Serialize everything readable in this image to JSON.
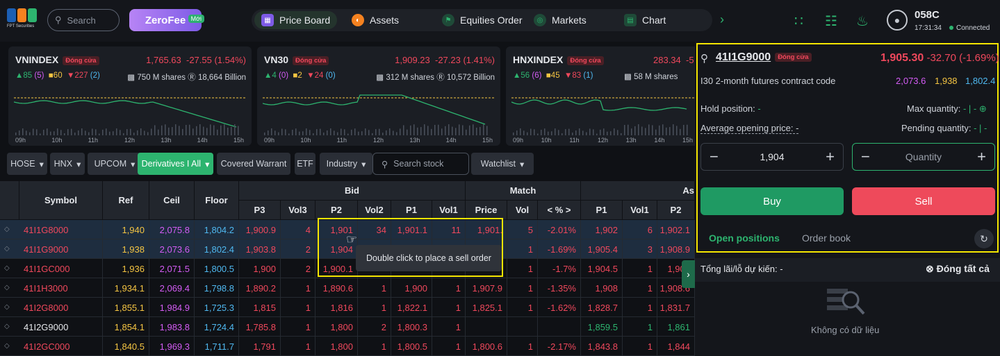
{
  "brand": {
    "logo_text": "FPT Securities",
    "logo_colors": [
      "#1c5fb4",
      "#f58220",
      "#2db46f"
    ]
  },
  "header": {
    "search_placeholder": "Search",
    "zerofee_label": "ZeroFee",
    "zerofee_badge": "Mới",
    "nav": [
      {
        "label": "Price Board",
        "icon": "price-board-icon",
        "active": true
      },
      {
        "label": "Assets",
        "icon": "assets-icon"
      },
      {
        "label": "Equities Order",
        "icon": "equities-order-icon"
      },
      {
        "label": "Markets",
        "icon": "markets-icon"
      },
      {
        "label": "Chart",
        "icon": "chart-icon"
      }
    ],
    "account_id": "058C",
    "time": "17:31:34",
    "connection": "Connected"
  },
  "indices": [
    {
      "name": "VNINDEX",
      "status": "Đóng cửa",
      "value": "1,765.63",
      "change": "-27.55 (1.54%)",
      "up": "85",
      "up_ceil": "(5)",
      "ref": "60",
      "down": "227",
      "down_floor": "(2)",
      "shares": "750 M shares",
      "value_traded": "18,664 Billion",
      "times": [
        "09h",
        "10h",
        "11h",
        "12h",
        "13h",
        "14h",
        "15h"
      ]
    },
    {
      "name": "VN30",
      "status": "Đóng cửa",
      "value": "1,909.23",
      "change": "-27.23 (1.41%)",
      "up": "4",
      "up_ceil": "(0)",
      "ref": "2",
      "down": "24",
      "down_floor": "(0)",
      "shares": "312 M shares",
      "value_traded": "10,572 Billion",
      "times": [
        "09h",
        "10h",
        "11h",
        "12h",
        "13h",
        "14h",
        "15h"
      ]
    },
    {
      "name": "HNXINDEX",
      "status": "Đóng cửa",
      "value": "283.34",
      "change": "-5",
      "up": "56",
      "up_ceil": "(6)",
      "ref": "45",
      "down": "83",
      "down_floor": "(1)",
      "shares": "58 M shares",
      "value_traded": "",
      "times": [
        "09h",
        "10h",
        "11h",
        "12h",
        "13h",
        "14h",
        "15h"
      ]
    }
  ],
  "filters": {
    "hose": "HOSE",
    "hnx": "HNX",
    "upcom": "UPCOM",
    "derivatives": "Derivatives I All",
    "cw": "Covered Warrant",
    "etf": "ETF",
    "industry": "Industry",
    "search_placeholder": "Search stock",
    "watchlist": "Watchlist"
  },
  "table": {
    "headers": {
      "symbol": "Symbol",
      "ref": "Ref",
      "ceil": "Ceil",
      "floor": "Floor",
      "bid": "Bid",
      "match": "Match",
      "ask": "As",
      "p3": "P3",
      "vol3": "Vol3",
      "p2": "P2",
      "vol2": "Vol2",
      "p1": "P1",
      "vol1": "Vol1",
      "price": "Price",
      "vol": "Vol",
      "pct": "< % >",
      "ap1": "P1",
      "avol1": "Vol1",
      "ap2": "P2"
    },
    "rows": [
      {
        "symbol": "41I1G8000",
        "ref": "1,940",
        "ceil": "2,075.8",
        "floor": "1,804.2",
        "p3": "1,900.9",
        "v3": "4",
        "p2": "1,901",
        "v2": "34",
        "p1": "1,901.1",
        "v1": "11",
        "price": "1,901.",
        "vol": "5",
        "pct": "-2.01%",
        "ap1": "1,902",
        "av1": "6",
        "ap2": "1,902.1",
        "sym_color": "dn"
      },
      {
        "symbol": "41I1G9000",
        "ref": "1,938",
        "ceil": "2,073.6",
        "floor": "1,802.4",
        "p3": "1,903.8",
        "v3": "2",
        "p2": "1,904",
        "v2": "",
        "p1": "",
        "v1": "",
        "price": "3",
        "vol": "1",
        "pct": "-1.69%",
        "ap1": "1,905.4",
        "av1": "3",
        "ap2": "1,908.9",
        "sym_color": "dn"
      },
      {
        "symbol": "41I1GC000",
        "ref": "1,936",
        "ceil": "2,071.5",
        "floor": "1,800.5",
        "p3": "1,900",
        "v3": "2",
        "p2": "1,900.1",
        "v2": "",
        "p1": "",
        "v1": "",
        "price": "",
        "vol": "1",
        "pct": "-1.7%",
        "ap1": "1,904.5",
        "av1": "1",
        "ap2": "1,908",
        "sym_color": "dn"
      },
      {
        "symbol": "41I1H3000",
        "ref": "1,934.1",
        "ceil": "2,069.4",
        "floor": "1,798.8",
        "p3": "1,890.2",
        "v3": "1",
        "p2": "1,890.6",
        "v2": "1",
        "p1": "1,900",
        "v1": "1",
        "price": "1,907.9",
        "vol": "1",
        "pct": "-1.35%",
        "ap1": "1,908",
        "av1": "1",
        "ap2": "1,908.6",
        "sym_color": "dn"
      },
      {
        "symbol": "41I2G8000",
        "ref": "1,855.1",
        "ceil": "1,984.9",
        "floor": "1,725.3",
        "p3": "1,815",
        "v3": "1",
        "p2": "1,816",
        "v2": "1",
        "p1": "1,822.1",
        "v1": "1",
        "price": "1,825.1",
        "vol": "1",
        "pct": "-1.62%",
        "ap1": "1,828.7",
        "av1": "1",
        "ap2": "1,831.7",
        "sym_color": "dn"
      },
      {
        "symbol": "41I2G9000",
        "ref": "1,854.1",
        "ceil": "1,983.8",
        "floor": "1,724.4",
        "p3": "1,785.8",
        "v3": "1",
        "p2": "1,800",
        "v2": "2",
        "p1": "1,800.3",
        "v1": "1",
        "price": "",
        "vol": "",
        "pct": "",
        "ap1": "1,859.5",
        "av1": "1",
        "ap2": "1,861",
        "sym_color": "wht"
      },
      {
        "symbol": "41I2GC000",
        "ref": "1,840.5",
        "ceil": "1,969.3",
        "floor": "1,711.7",
        "p3": "1,791",
        "v3": "1",
        "p2": "1,800",
        "v2": "1",
        "p1": "1,800.5",
        "v1": "1",
        "price": "1,800.6",
        "vol": "1",
        "pct": "-2.17%",
        "ap1": "1,843.8",
        "av1": "1",
        "ap2": "1,844",
        "sym_color": "dn"
      }
    ]
  },
  "tooltip": "Double click to place a sell order",
  "order_panel": {
    "symbol": "41I1G9000",
    "status": "Đóng cửa",
    "price": "1,905.30",
    "change": "-32.70 (-1.69%)",
    "description": "I30 2-month futures contract code",
    "ceil": "2,073.6",
    "ref": "1,938",
    "floor": "1,802.4",
    "hold_label": "Hold position:",
    "hold_value": "-",
    "max_label": "Max quantity:",
    "max_value": "- | -",
    "avg_label": "Average opening price:",
    "avg_value": "-",
    "pending_label": "Pending quantity:",
    "pending_value": "- | -",
    "price_input": "1,904",
    "quantity_placeholder": "Quantity",
    "buy_label": "Buy",
    "sell_label": "Sell",
    "tab_open": "Open positions",
    "tab_book": "Order book",
    "pnl_label": "Tổng lãi/lỗ dự kiến:",
    "pnl_value": "-",
    "close_all": "Đóng tất cả",
    "empty_text": "Không có dữ liệu"
  },
  "colors": {
    "up": "#2db46f",
    "ref": "#f5c542",
    "down": "#f0485c",
    "floor": "#4fb8f0",
    "ceil": "#d45cf5",
    "highlight": "#f5e600"
  }
}
